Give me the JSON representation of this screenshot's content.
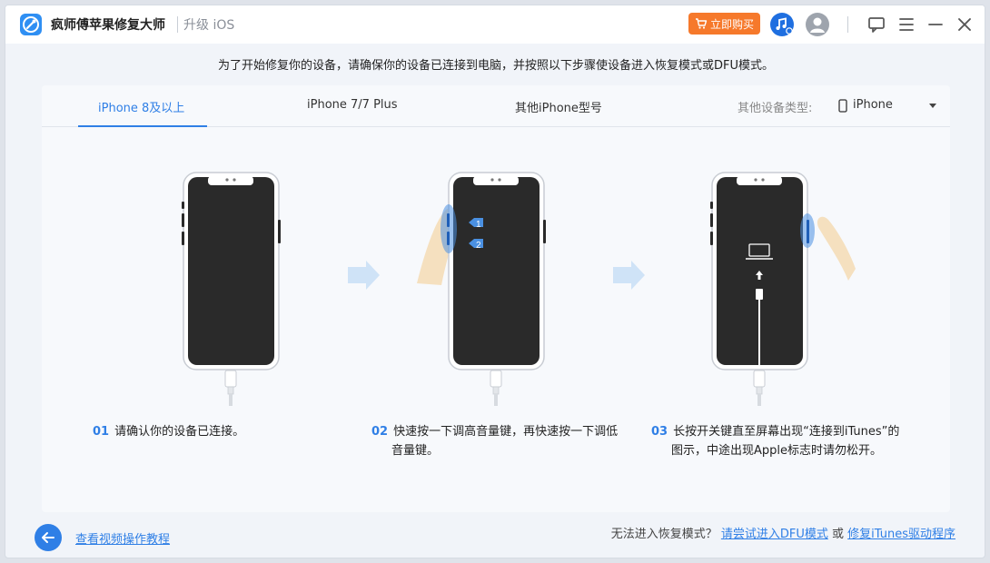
{
  "app": {
    "title": "疯师傅苹果修复大师",
    "subtitle": "升级 iOS"
  },
  "toolbar": {
    "buy_label": "立即购买",
    "accent_color": "#f6792b",
    "icons": [
      "cart-icon",
      "music-icon",
      "avatar-icon",
      "chat-icon",
      "menu-icon",
      "minimize-icon",
      "close-icon"
    ]
  },
  "instruction": "为了开始修复你的设备，请确保你的设备已连接到电脑，并按照以下步骤使设备进入恢复模式或DFU模式。",
  "tabs": [
    {
      "label": "iPhone 8及以上",
      "active": true
    },
    {
      "label": "iPhone 7/7 Plus",
      "active": false
    },
    {
      "label": "其他iPhone型号",
      "active": false
    }
  ],
  "device_type": {
    "label": "其他设备类型:",
    "value": "iPhone"
  },
  "steps": [
    {
      "num": "01",
      "text": "请确认你的设备已连接。"
    },
    {
      "num": "02",
      "text": "快速按一下调高音量键，再快速按一下调低音量键。",
      "badges": [
        "1",
        "2"
      ]
    },
    {
      "num": "03",
      "text": "长按开关键直至屏幕出现“连接到iTunes”的图示，中途出现Apple标志时请勿松开。"
    }
  ],
  "footer": {
    "video_link": "查看视频操作教程",
    "question": "无法进入恢复模式？",
    "dfu_link": "请尝试进入DFU模式",
    "or": "或",
    "itunes_link": "修复iTunes驱动程序"
  },
  "colors": {
    "accent": "#2f7fe6",
    "buy": "#f6792b",
    "phone_screen": "#2a2a2a"
  }
}
